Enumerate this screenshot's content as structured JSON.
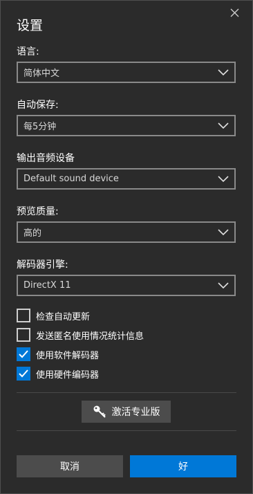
{
  "dialog": {
    "title": "设置",
    "close_icon": "close-icon"
  },
  "settings": {
    "language": {
      "label": "语言:",
      "value": "简体中文"
    },
    "autosave": {
      "label": "自动保存:",
      "value": "每5分钟"
    },
    "audio_output": {
      "label": "输出音频设备",
      "value": "Default sound device"
    },
    "preview_quality": {
      "label": "预览质量:",
      "value": "高的"
    },
    "decoder_engine": {
      "label": "解码器引擎:",
      "value": "DirectX 11"
    }
  },
  "checkboxes": [
    {
      "label": "检查自动更新",
      "checked": false
    },
    {
      "label": "发送匿名使用情况统计信息",
      "checked": false
    },
    {
      "label": "使用软件解码器",
      "checked": true
    },
    {
      "label": "使用硬件编码器",
      "checked": true
    }
  ],
  "activate": {
    "label": "激活专业版",
    "icon": "key-icon"
  },
  "buttons": {
    "cancel": "取消",
    "ok": "好"
  },
  "colors": {
    "accent": "#0078d7",
    "background": "#2b2b2b",
    "button": "#4c4c4c"
  }
}
